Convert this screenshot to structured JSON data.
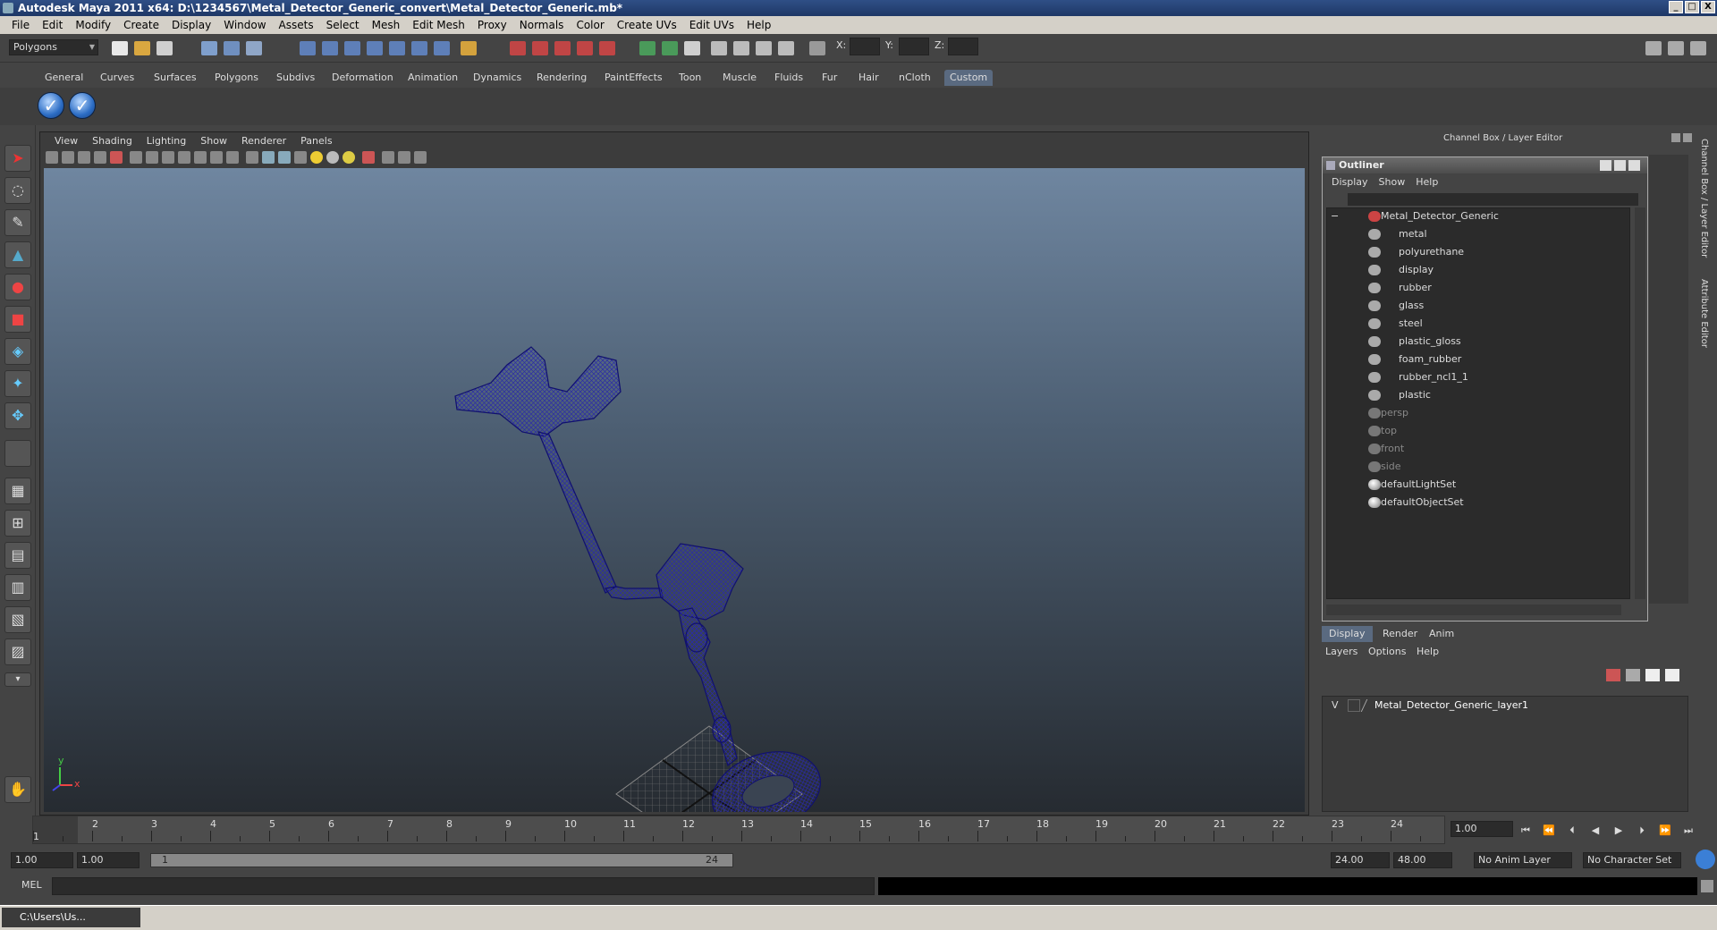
{
  "window": {
    "title": "Autodesk Maya 2011 x64: D:\\1234567\\Metal_Detector_Generic_convert\\Metal_Detector_Generic.mb*",
    "controls": [
      "_",
      "□",
      "X"
    ]
  },
  "menubar": [
    "File",
    "Edit",
    "Modify",
    "Create",
    "Display",
    "Window",
    "Assets",
    "Select",
    "Mesh",
    "Edit Mesh",
    "Proxy",
    "Normals",
    "Color",
    "Create UVs",
    "Edit UVs",
    "Help"
  ],
  "statusline": {
    "mode": "Polygons",
    "x_label": "X:",
    "y_label": "Y:",
    "z_label": "Z:"
  },
  "shelf": {
    "tabs": [
      "General",
      "Curves",
      "Surfaces",
      "Polygons",
      "Subdivs",
      "Deformation",
      "Animation",
      "Dynamics",
      "Rendering",
      "PaintEffects",
      "Toon",
      "Muscle",
      "Fluids",
      "Fur",
      "Hair",
      "nCloth",
      "Custom"
    ],
    "active_tab": "Custom"
  },
  "viewport": {
    "menu": [
      "View",
      "Shading",
      "Lighting",
      "Show",
      "Renderer",
      "Panels"
    ],
    "axis_y": "y",
    "axis_x": "x"
  },
  "channel_box_title": "Channel Box / Layer Editor",
  "outliner": {
    "title": "Outliner",
    "menu": [
      "Display",
      "Show",
      "Help"
    ],
    "root": "Metal_Detector_Generic",
    "children": [
      "metal",
      "polyurethane",
      "display",
      "rubber",
      "glass",
      "steel",
      "plastic_gloss",
      "foam_rubber",
      "rubber_ncl1_1",
      "plastic"
    ],
    "cameras": [
      "persp",
      "top",
      "front",
      "side"
    ],
    "sets": [
      "defaultLightSet",
      "defaultObjectSet"
    ],
    "collapse_sign": "−"
  },
  "layer_editor": {
    "tabs": [
      "Display",
      "Render",
      "Anim"
    ],
    "active_tab": "Display",
    "menu": [
      "Layers",
      "Options",
      "Help"
    ],
    "layer_visibility": "V",
    "layer_name": "Metal_Detector_Generic_layer1"
  },
  "side_tabs": [
    "Channel Box / Layer Editor",
    "Attribute Editor"
  ],
  "timeline": {
    "ticks": [
      "1",
      "2",
      "3",
      "4",
      "5",
      "6",
      "7",
      "8",
      "9",
      "10",
      "11",
      "12",
      "13",
      "14",
      "15",
      "16",
      "17",
      "18",
      "19",
      "20",
      "21",
      "22",
      "23",
      "24"
    ],
    "current_frame_marker": "1",
    "current_time": "1.00"
  },
  "range": {
    "start_time": "1.00",
    "playback_start": "1.00",
    "range_start_label": "1",
    "range_end_label": "24",
    "playback_end": "24.00",
    "end_time": "48.00",
    "anim_layer": "No Anim Layer",
    "character_set": "No Character Set"
  },
  "command_line": {
    "label": "MEL"
  },
  "taskbar": {
    "item": "C:\\Users\\Us..."
  },
  "colors": {
    "mesh": "#1a1a8a",
    "active_tab": "#5a6a80"
  }
}
